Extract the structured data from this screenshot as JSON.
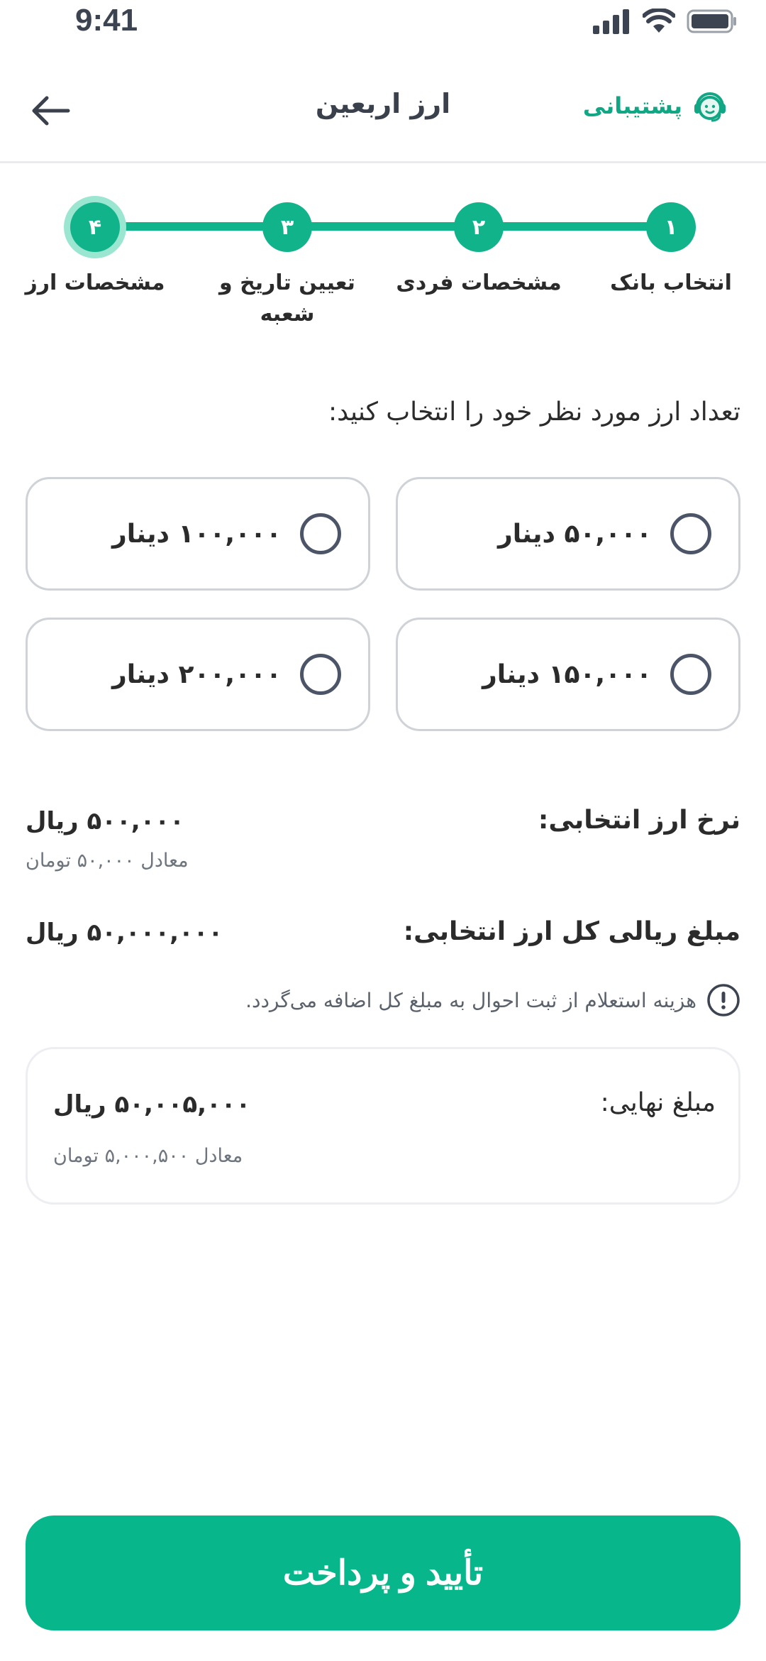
{
  "status_bar": {
    "time": "9:41"
  },
  "header": {
    "title": "ارز اربعین",
    "support_label": "پشتیبانی"
  },
  "stepper": {
    "steps": [
      {
        "number": "۱",
        "label": "انتخاب بانک"
      },
      {
        "number": "۲",
        "label": "مشخصات فردی"
      },
      {
        "number": "۳",
        "label": "تعیین تاریخ و شعبه"
      },
      {
        "number": "۴",
        "label": "مشخصات ارز"
      }
    ],
    "current_step": 4
  },
  "question": "تعداد ارز مورد نظر خود را انتخاب کنید:",
  "options": [
    {
      "label": "۵۰,۰۰۰ دینار"
    },
    {
      "label": "۱۰۰,۰۰۰ دینار"
    },
    {
      "label": "۱۵۰,۰۰۰ دینار"
    },
    {
      "label": "۲۰۰,۰۰۰ دینار"
    }
  ],
  "rate": {
    "label": "نرخ ارز انتخابی:",
    "value": "۵۰۰,۰۰۰ ریال",
    "equivalent": "معادل ۵۰,۰۰۰ تومان"
  },
  "total": {
    "label": "مبلغ ریالی کل ارز انتخابی:",
    "value": "۵۰,۰۰۰,۰۰۰ ریال"
  },
  "notice": "هزینه استعلام از ثبت احوال به مبلغ کل اضافه می‌گردد.",
  "final": {
    "label": "مبلغ نهایی:",
    "value": "۵۰,۰۰۵,۰۰۰ ریال",
    "equivalent": "معادل ۵,۰۰۰,۵۰۰ تومان"
  },
  "confirm_button": "تأیید و پرداخت",
  "colors": {
    "accent": "#07b68b",
    "accent_light": "#9be6d0",
    "text": "#2b2b2b",
    "muted": "#6e757f",
    "border": "#cfd3d8"
  }
}
